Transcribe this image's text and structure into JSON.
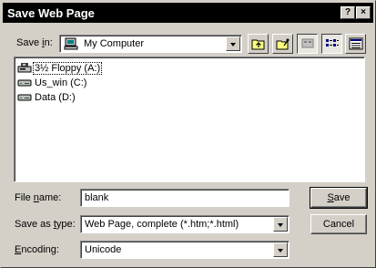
{
  "window": {
    "title": "Save Web Page",
    "help_glyph": "?",
    "close_glyph": "×"
  },
  "save_in": {
    "label_pre": "Save ",
    "label_u": "i",
    "label_post": "n:",
    "value": "My Computer",
    "icon": "my-computer-icon"
  },
  "toolbar": {
    "buttons": [
      {
        "name": "up-one-level-button",
        "icon": "folder-up-icon"
      },
      {
        "name": "create-new-folder-button",
        "icon": "new-folder-icon"
      },
      {
        "name": "desktop-button",
        "icon": "desktop-icon"
      },
      {
        "name": "list-view-button",
        "icon": "list-view-icon"
      },
      {
        "name": "details-view-button",
        "icon": "details-view-icon"
      }
    ]
  },
  "drives": [
    {
      "label": "3½ Floppy (A:)",
      "icon": "floppy-drive-icon",
      "selected": true
    },
    {
      "label": "Us_win (C:)",
      "icon": "hard-drive-icon",
      "selected": false
    },
    {
      "label": "Data (D:)",
      "icon": "hard-drive-icon",
      "selected": false
    }
  ],
  "file_name": {
    "label_pre": "File ",
    "label_u": "n",
    "label_post": "ame:",
    "value": "blank"
  },
  "save_as_type": {
    "label_pre": "Save as ",
    "label_u": "t",
    "label_post": "ype:",
    "value": "Web Page, complete (*.htm;*.html)"
  },
  "encoding": {
    "label_u": "E",
    "label_post": "ncoding:",
    "value": "Unicode"
  },
  "buttons": {
    "save_u": "S",
    "save_rest": "ave",
    "cancel": "Cancel"
  }
}
